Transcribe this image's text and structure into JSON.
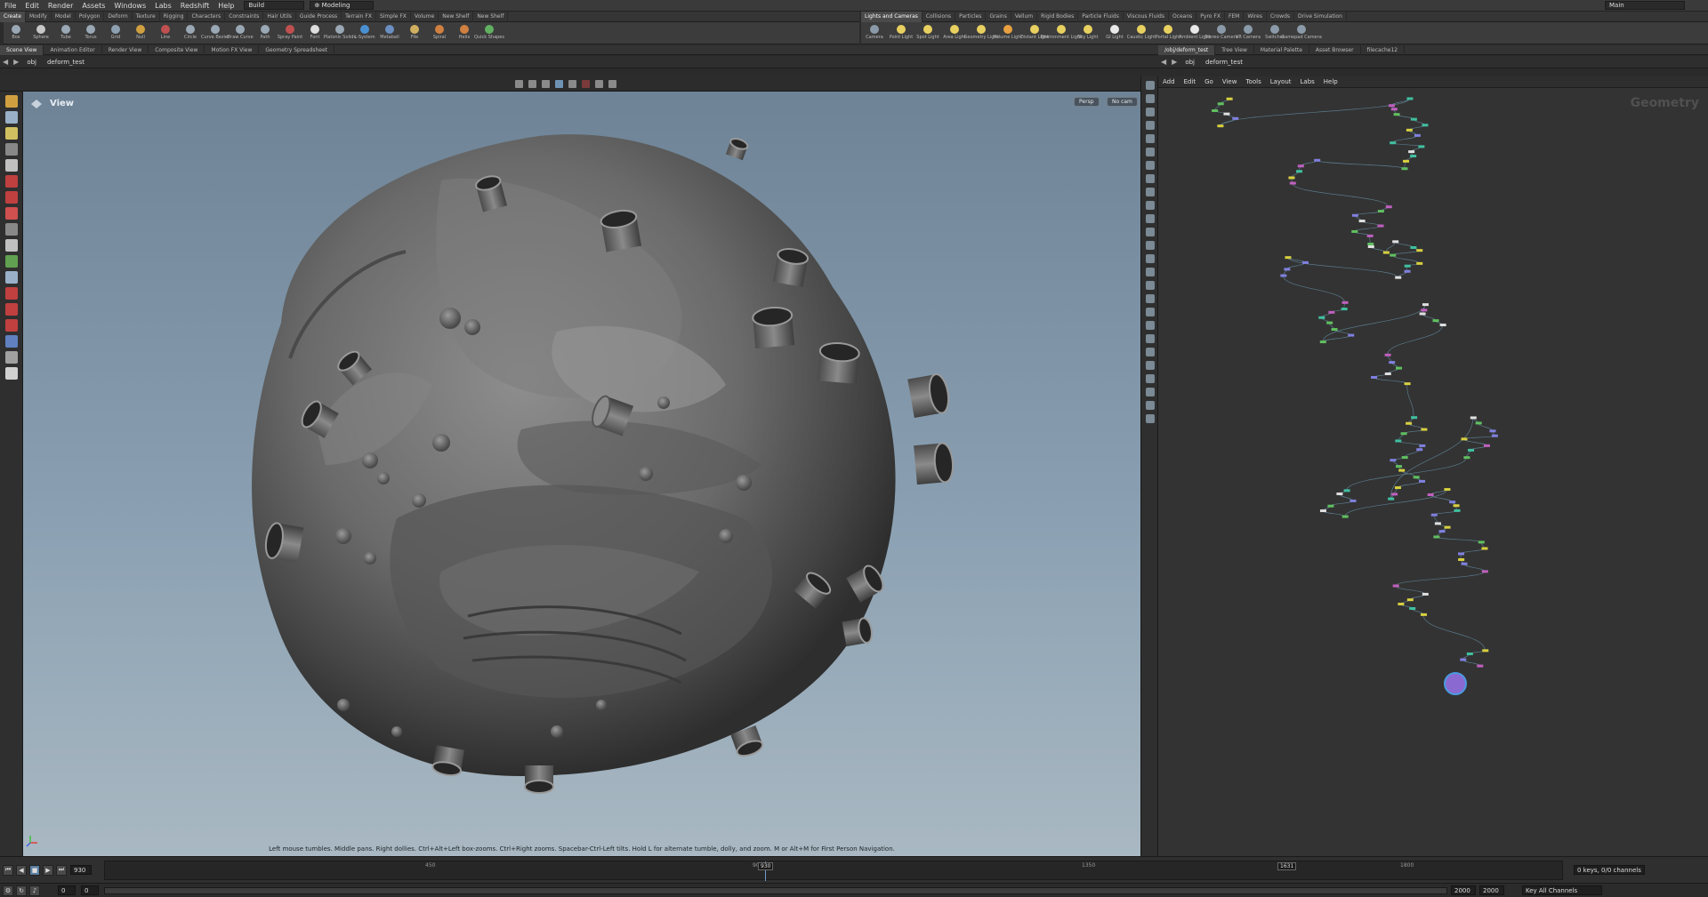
{
  "menubar": {
    "items": [
      "File",
      "Edit",
      "Render",
      "Assets",
      "Windows",
      "Labs",
      "Redshift",
      "Help"
    ],
    "build": "Build",
    "desktop": "Modeling",
    "workspace": "Main"
  },
  "shelf_left": {
    "tabs": [
      "Create",
      "Modify",
      "Model",
      "Polygon",
      "Deform",
      "Texture",
      "Rigging",
      "Characters",
      "Constraints",
      "Hair Utils",
      "Guide Process",
      "Terrain FX",
      "Simple FX",
      "Volume",
      "New Shelf",
      "New Shelf"
    ],
    "tools": [
      {
        "label": "Box",
        "color": "#9aa7b4"
      },
      {
        "label": "Sphere",
        "color": "#c7c7c7"
      },
      {
        "label": "Tube",
        "color": "#9aa7b4"
      },
      {
        "label": "Torus",
        "color": "#9aa7b4"
      },
      {
        "label": "Grid",
        "color": "#8da0b0"
      },
      {
        "label": "Null",
        "color": "#d0a040"
      },
      {
        "label": "Line",
        "color": "#c05050"
      },
      {
        "label": "Circle",
        "color": "#9aa7b4"
      },
      {
        "label": "Curve Bezier",
        "color": "#9aa7b4"
      },
      {
        "label": "Draw Curve",
        "color": "#9aa7b4"
      },
      {
        "label": "Path",
        "color": "#9aa7b4"
      },
      {
        "label": "Spray Paint",
        "color": "#c05050"
      },
      {
        "label": "Font",
        "color": "#dddddd"
      },
      {
        "label": "Platonic Solids",
        "color": "#9aa7b4"
      },
      {
        "label": "L-System",
        "color": "#4a8fd0"
      },
      {
        "label": "Metaball",
        "color": "#6a8fc0"
      },
      {
        "label": "File",
        "color": "#d0b060"
      },
      {
        "label": "Spiral",
        "color": "#d08040"
      },
      {
        "label": "Helix",
        "color": "#d08040"
      },
      {
        "label": "Quick Shapes",
        "color": "#60b060"
      }
    ]
  },
  "shelf_right": {
    "tabs": [
      "Lights and Cameras",
      "Collisions",
      "Particles",
      "Grains",
      "Vellum",
      "Rigid Bodies",
      "Particle Fluids",
      "Viscous Fluids",
      "Oceans",
      "Pyro FX",
      "FEM",
      "Wires",
      "Crowds",
      "Drive Simulation"
    ],
    "tools": [
      {
        "label": "Camera",
        "color": "#8a9aa8"
      },
      {
        "label": "Point Light",
        "color": "#e8d060"
      },
      {
        "label": "Spot Light",
        "color": "#e8d060"
      },
      {
        "label": "Area Light",
        "color": "#e8d060"
      },
      {
        "label": "Geometry Light",
        "color": "#e8d060"
      },
      {
        "label": "Volume Light",
        "color": "#e8a040"
      },
      {
        "label": "Distant Light",
        "color": "#e8d060"
      },
      {
        "label": "Environment Light",
        "color": "#e8d060"
      },
      {
        "label": "Sky Light",
        "color": "#e8d060"
      },
      {
        "label": "GI Light",
        "color": "#e8e8e8"
      },
      {
        "label": "Caustic Light",
        "color": "#e8d060"
      },
      {
        "label": "Portal Light",
        "color": "#e8d060"
      },
      {
        "label": "Ambient Light",
        "color": "#e8e8e8"
      },
      {
        "label": "Stereo Camera",
        "color": "#8a9aa8"
      },
      {
        "label": "VR Camera",
        "color": "#8a9aa8"
      },
      {
        "label": "Switcher",
        "color": "#8a9aa8"
      },
      {
        "label": "Gamepad Camera",
        "color": "#8a9aa8"
      }
    ]
  },
  "left_pane": {
    "tabs": [
      "Scene View",
      "Animation Editor",
      "Render View",
      "Composite View",
      "Motion FX View",
      "Geometry Spreadsheet"
    ],
    "path": {
      "context": "obj",
      "node": "deform_test"
    },
    "viewport": {
      "label": "View",
      "persp": "Persp",
      "cam": "No cam",
      "hint": "Left mouse tumbles. Middle pans. Right dollies. Ctrl+Alt+Left box-zooms. Ctrl+Right zooms. Spacebar-Ctrl-Left tilts. Hold L for alternate tumble, dolly, and zoom. M or Alt+M for First Person Navigation."
    }
  },
  "right_pane": {
    "tabs": [
      "/obj/deform_test",
      "Tree View",
      "Material Palette",
      "Asset Browser",
      "filecache12"
    ],
    "path": {
      "context": "obj",
      "node": "deform_test"
    },
    "menu": [
      "Add",
      "Edit",
      "Go",
      "View",
      "Tools",
      "Layout",
      "Labs",
      "Help"
    ],
    "watermark": "Geometry"
  },
  "timeline": {
    "current_frame": "930",
    "ticks": [
      "450",
      "900",
      "1350",
      "1800"
    ],
    "marker_frame": "930",
    "marker_frame_2": "1631",
    "start": "0",
    "start2": "0",
    "end": "2000",
    "end2": "2000",
    "keys_info": "0 keys, 0/0 channels",
    "key_all": "Key All Channels"
  }
}
